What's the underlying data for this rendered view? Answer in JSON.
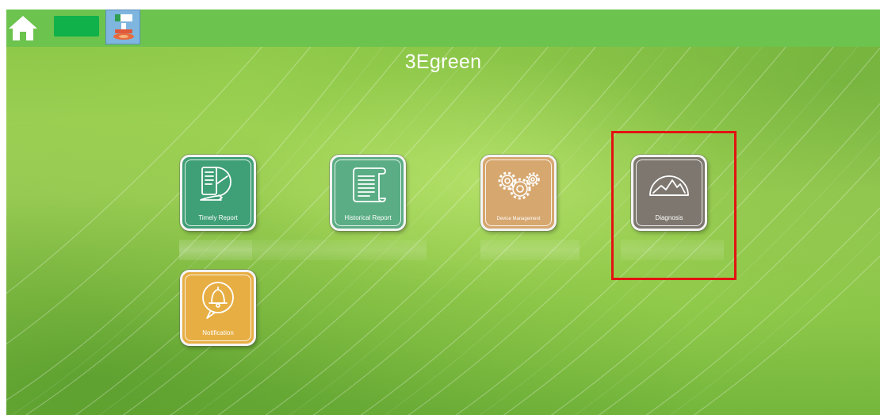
{
  "app": {
    "title": "3Egreen"
  },
  "topbar": {
    "home_icon": "home-icon",
    "green_button_icon": "green-button",
    "tool_icon": "stamp-tool-icon",
    "colors": {
      "bar": "#6cc34d",
      "green_button": "#10b04a",
      "tool_bg": "#7fb6df"
    }
  },
  "tiles": [
    {
      "label": "Timely Report",
      "icon": "report-chart-icon",
      "color": "#3f9f76"
    },
    {
      "label": "Historical Report",
      "icon": "scroll-document-icon",
      "color": "#5aad84"
    },
    {
      "label": "Device Management",
      "icon": "gears-icon",
      "color": "#d6a76f"
    },
    {
      "label": "Diagnosis",
      "icon": "gauge-icon",
      "color": "#7d776f"
    },
    {
      "label": "Notification",
      "icon": "bell-icon",
      "color": "#e7ae44"
    }
  ],
  "highlight": {
    "target": "Diagnosis",
    "color": "#e31212"
  }
}
